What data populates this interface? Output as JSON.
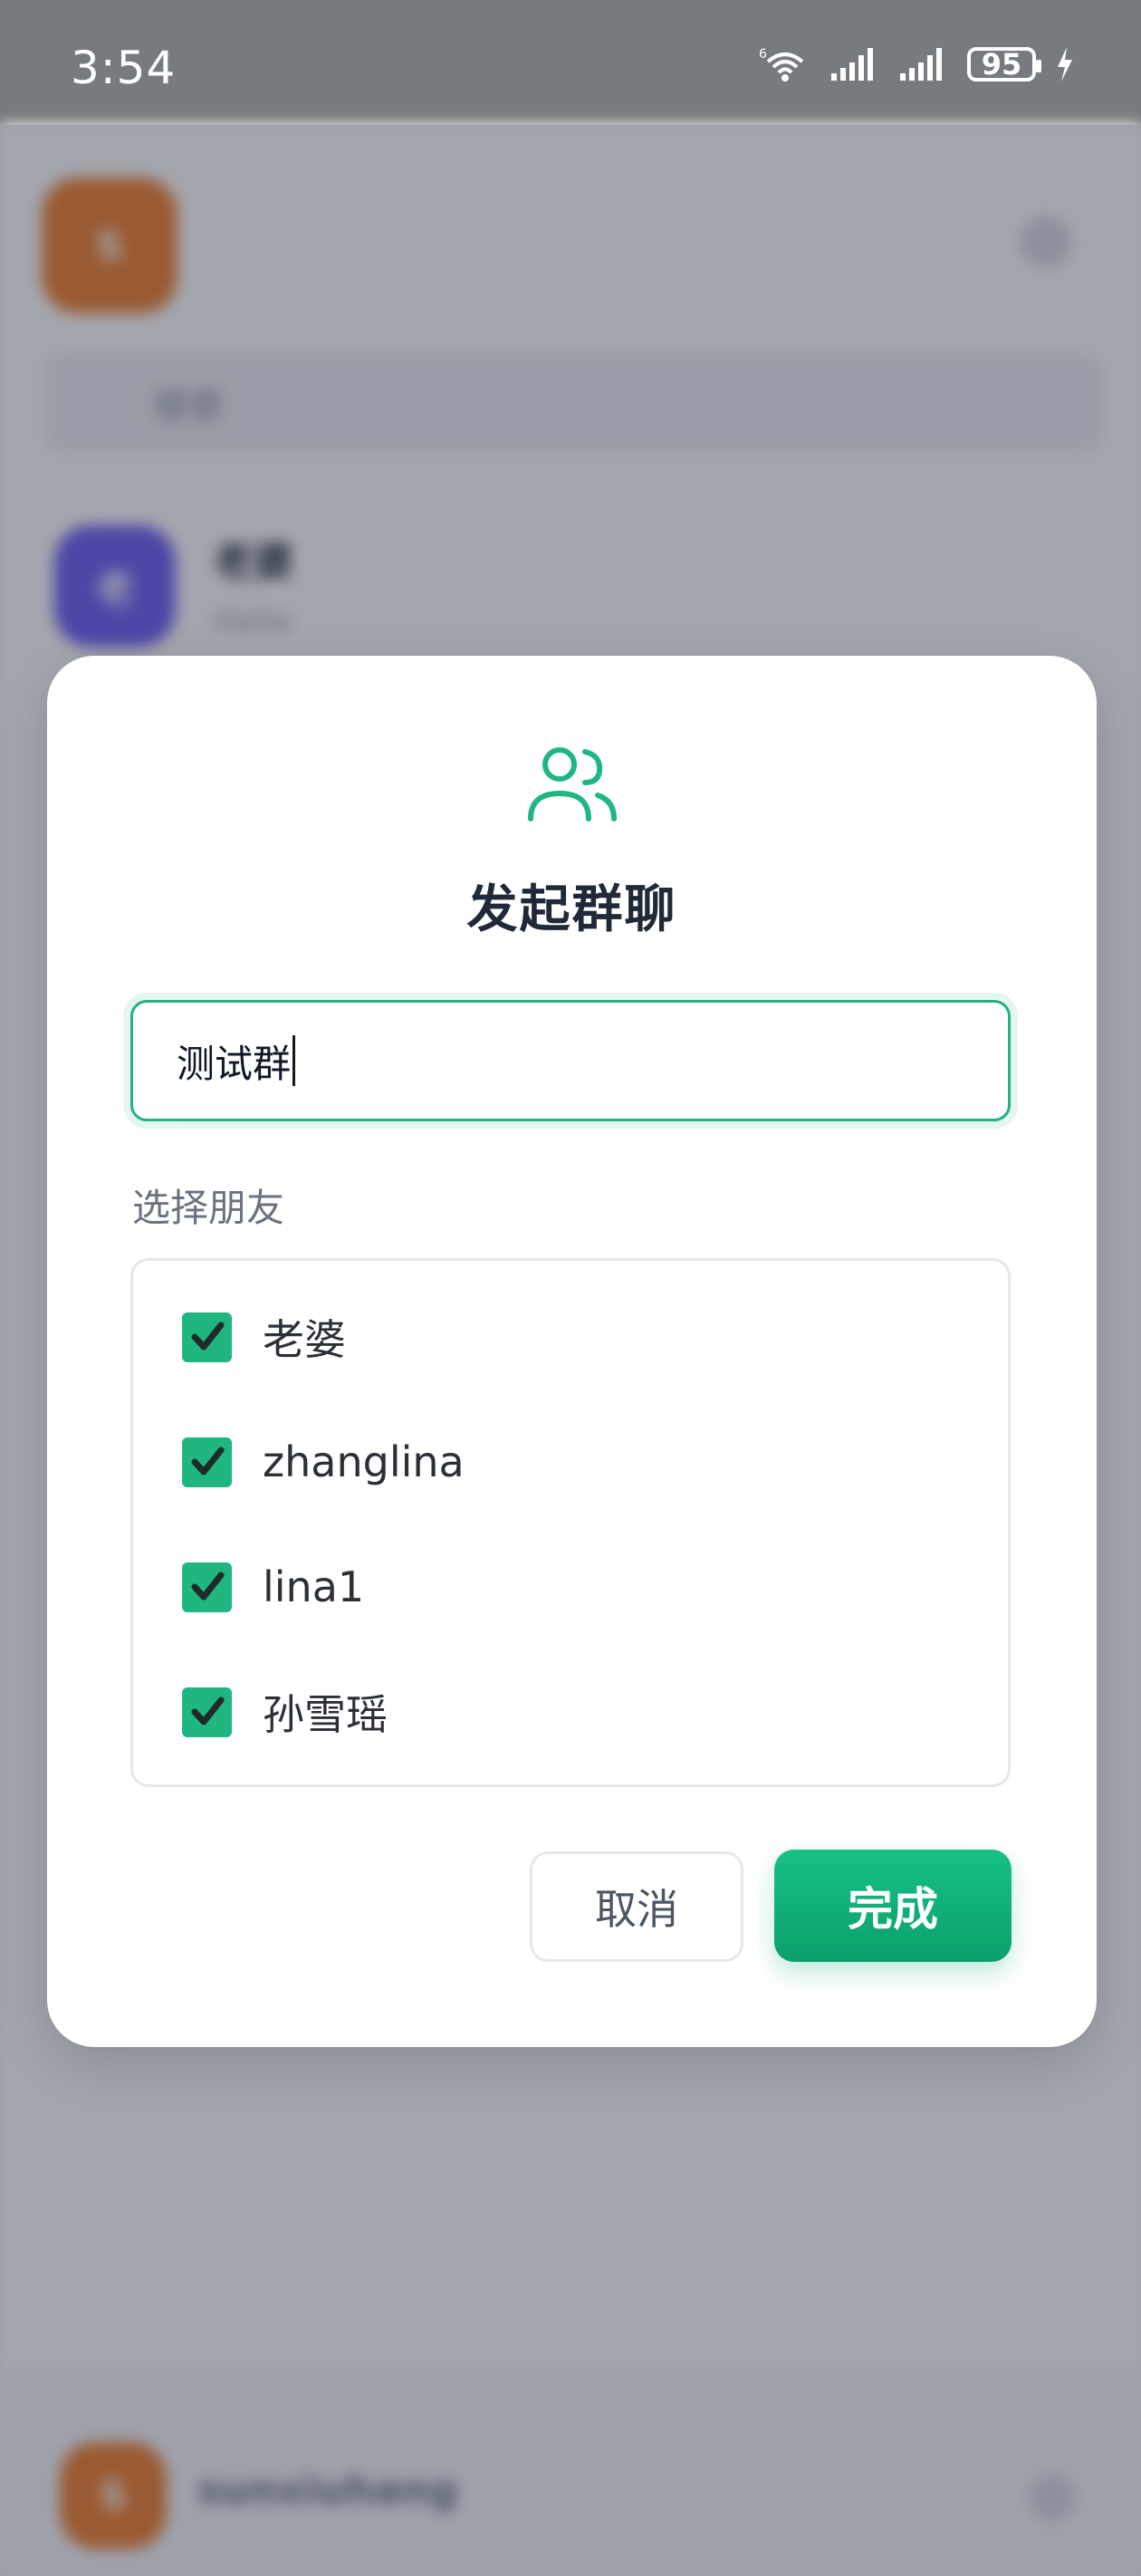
{
  "status_bar": {
    "time": "3:54",
    "network_label": "6",
    "battery": "95"
  },
  "background": {
    "search_placeholder": "搜索",
    "first_chat_title": "老婆",
    "first_chat_subtitle": "Hello",
    "bottom_user": "sunxiuhang"
  },
  "modal": {
    "title": "发起群聊",
    "group_name_value": "测试群",
    "section_label": "选择朋友",
    "friends": [
      {
        "name": "老婆",
        "checked": true
      },
      {
        "name": "zhanglina",
        "checked": true
      },
      {
        "name": "lina1",
        "checked": true
      },
      {
        "name": "孙雪瑶",
        "checked": true
      }
    ],
    "cancel_label": "取消",
    "done_label": "完成"
  },
  "colors": {
    "accent": "#1fb67f",
    "title_text": "#1f2937",
    "muted_text": "#6b7280"
  }
}
